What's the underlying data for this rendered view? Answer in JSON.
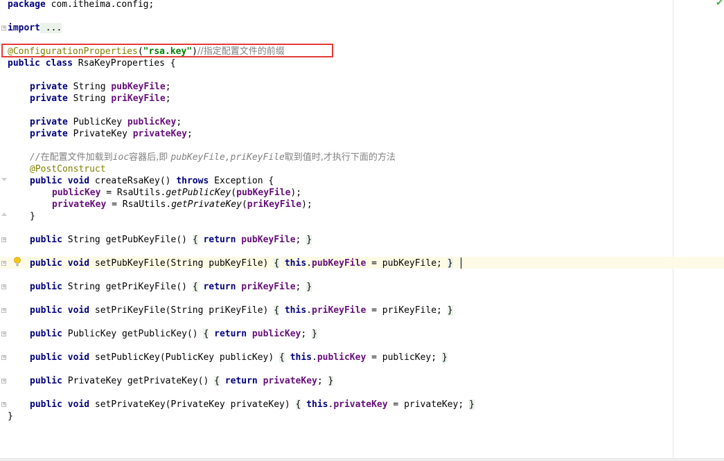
{
  "editor": {
    "status": "no-problems",
    "code": {
      "package_kw": "package",
      "package_name": " com.itheima.config;",
      "import_kw": "import",
      "import_folded": " ...",
      "annotation_name": "@ConfigurationProperties",
      "annotation_open": "(",
      "annotation_value": "\"rsa.key\"",
      "annotation_close": ")",
      "annotation_comment": "//指定配置文件的前缀",
      "class_modifiers": "public class",
      "class_name": " RsaKeyProperties {",
      "f1_mod": "private",
      "f1_type": " String ",
      "f1_name": "pubKeyFile",
      "f1_end": ";",
      "f2_mod": "private",
      "f2_type": " String ",
      "f2_name": "priKeyFile",
      "f2_end": ";",
      "f3_mod": "private",
      "f3_type": " PublicKey ",
      "f3_name": "publicKey",
      "f3_end": ";",
      "f4_mod": "private",
      "f4_type": " PrivateKey ",
      "f4_name": "privateKey",
      "f4_end": ";",
      "comment_a": "//",
      "comment_b": "在配置文件加载到",
      "comment_c": "ioc",
      "comment_d": "容器后,即 ",
      "comment_e": "pubKeyFile,priKeyFile",
      "comment_f": "取到值时,才执行下面的方法",
      "post_construct": "@PostConstruct",
      "m_create_mod": "public void",
      "m_create_sig": " createRsaKey() ",
      "m_create_throws": "throws",
      "m_create_rest": " Exception {",
      "b1_field": "publicKey",
      "b1_mid": " = RsaUtils.",
      "b1_call": "getPublicKey",
      "b1_open": "(",
      "b1_arg": "pubKeyFile",
      "b1_end": ");",
      "b2_field": "privateKey",
      "b2_mid": " = RsaUtils.",
      "b2_call": "getPrivateKey",
      "b2_open": "(",
      "b2_arg": "priKeyFile",
      "b2_end": ");",
      "m_create_close": "}",
      "g1_mod": "public",
      "g1_sig": " String getPubKeyFile() ",
      "g1_ob": "{",
      "g1_ret": "return",
      "g1_sp": " ",
      "g1_fld": "pubKeyFile",
      "g1_semi": ";",
      "g1_cb": "}",
      "s1_mod": "public void",
      "s1_sig": " setPubKeyFile(String pubKeyFile) ",
      "s1_ob": "{",
      "s1_this": "this",
      "s1_dot": ".",
      "s1_fld": "pubKeyFile",
      "s1_rest": " = pubKeyFile;",
      "s1_cb": "}",
      "g2_mod": "public",
      "g2_sig": " String getPriKeyFile() ",
      "g2_ob": "{",
      "g2_ret": "return",
      "g2_sp": " ",
      "g2_fld": "priKeyFile",
      "g2_semi": ";",
      "g2_cb": "}",
      "s2_mod": "public void",
      "s2_sig": " setPriKeyFile(String priKeyFile) ",
      "s2_ob": "{",
      "s2_this": "this",
      "s2_dot": ".",
      "s2_fld": "priKeyFile",
      "s2_rest": " = priKeyFile;",
      "s2_cb": "}",
      "g3_mod": "public",
      "g3_sig": " PublicKey getPublicKey() ",
      "g3_ob": "{",
      "g3_ret": "return",
      "g3_sp": " ",
      "g3_fld": "publicKey",
      "g3_semi": ";",
      "g3_cb": "}",
      "s3_mod": "public void",
      "s3_sig": " setPublicKey(PublicKey publicKey) ",
      "s3_ob": "{",
      "s3_this": "this",
      "s3_dot": ".",
      "s3_fld": "publicKey",
      "s3_rest": " = publicKey;",
      "s3_cb": "}",
      "g4_mod": "public",
      "g4_sig": " PrivateKey getPrivateKey() ",
      "g4_ob": "{",
      "g4_ret": "return",
      "g4_sp": " ",
      "g4_fld": "privateKey",
      "g4_semi": ";",
      "g4_cb": "}",
      "s4_mod": "public void",
      "s4_sig": " setPrivateKey(PrivateKey privateKey) ",
      "s4_ob": "{",
      "s4_this": "this",
      "s4_dot": ".",
      "s4_fld": "privateKey",
      "s4_rest": " = privateKey;",
      "s4_cb": "}",
      "class_close": "}"
    },
    "colors": {
      "keyword": "#000080",
      "annotation": "#808000",
      "string": "#008000",
      "field": "#660e7a",
      "comment": "#808080",
      "highlight_box": "#e53935",
      "current_line": "#fdfbe6"
    },
    "icons": {
      "status": "check-icon",
      "intention": "lightbulb-icon"
    }
  }
}
